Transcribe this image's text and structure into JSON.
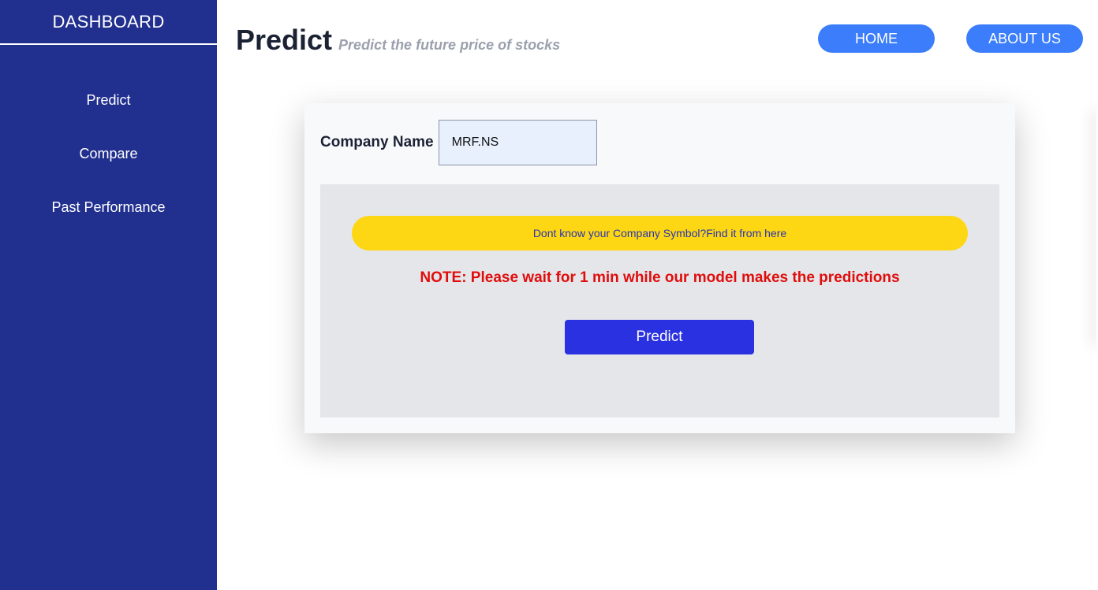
{
  "sidebar": {
    "title": "DASHBOARD",
    "items": [
      {
        "label": "Predict"
      },
      {
        "label": "Compare"
      },
      {
        "label": "Past Performance"
      }
    ]
  },
  "header": {
    "title": "Predict",
    "subtitle": "Predict the future price of stocks",
    "nav": {
      "home_label": "HOME",
      "about_label": "ABOUT US"
    }
  },
  "form": {
    "company_label": "Company Name",
    "company_value": "MRF.NS",
    "symbol_link_label": "Dont know your Company Symbol?Find it from here",
    "note": "NOTE: Please wait for 1 min while our model makes the predictions",
    "predict_label": "Predict"
  },
  "colors": {
    "sidebar_bg": "#21308e",
    "nav_button": "#3b7dfa",
    "symbol_link_bg": "#fdd714",
    "note_text": "#e00d0d",
    "predict_button": "#2a31e0"
  }
}
